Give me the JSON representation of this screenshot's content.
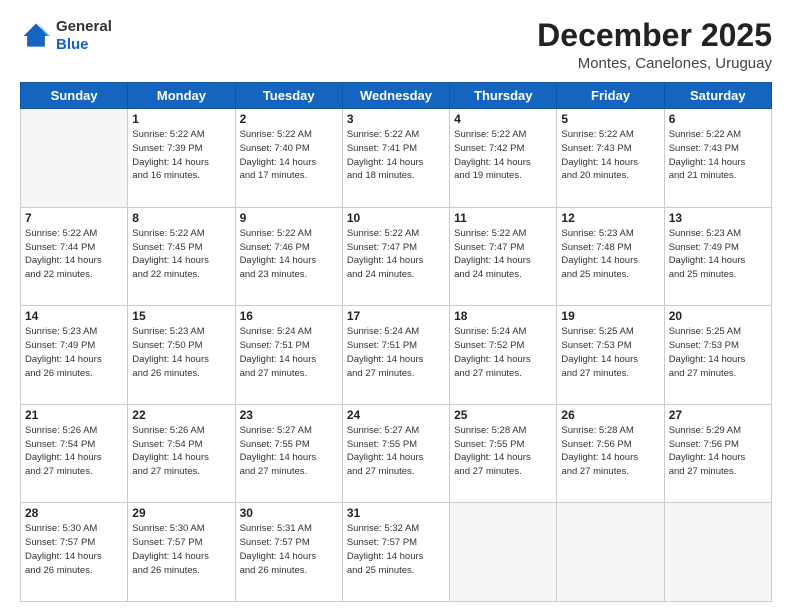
{
  "header": {
    "logo_line1": "General",
    "logo_line2": "Blue",
    "month": "December 2025",
    "location": "Montes, Canelones, Uruguay"
  },
  "days_of_week": [
    "Sunday",
    "Monday",
    "Tuesday",
    "Wednesday",
    "Thursday",
    "Friday",
    "Saturday"
  ],
  "weeks": [
    [
      {
        "day": "",
        "info": ""
      },
      {
        "day": "1",
        "info": "Sunrise: 5:22 AM\nSunset: 7:39 PM\nDaylight: 14 hours\nand 16 minutes."
      },
      {
        "day": "2",
        "info": "Sunrise: 5:22 AM\nSunset: 7:40 PM\nDaylight: 14 hours\nand 17 minutes."
      },
      {
        "day": "3",
        "info": "Sunrise: 5:22 AM\nSunset: 7:41 PM\nDaylight: 14 hours\nand 18 minutes."
      },
      {
        "day": "4",
        "info": "Sunrise: 5:22 AM\nSunset: 7:42 PM\nDaylight: 14 hours\nand 19 minutes."
      },
      {
        "day": "5",
        "info": "Sunrise: 5:22 AM\nSunset: 7:43 PM\nDaylight: 14 hours\nand 20 minutes."
      },
      {
        "day": "6",
        "info": "Sunrise: 5:22 AM\nSunset: 7:43 PM\nDaylight: 14 hours\nand 21 minutes."
      }
    ],
    [
      {
        "day": "7",
        "info": "Sunrise: 5:22 AM\nSunset: 7:44 PM\nDaylight: 14 hours\nand 22 minutes."
      },
      {
        "day": "8",
        "info": "Sunrise: 5:22 AM\nSunset: 7:45 PM\nDaylight: 14 hours\nand 22 minutes."
      },
      {
        "day": "9",
        "info": "Sunrise: 5:22 AM\nSunset: 7:46 PM\nDaylight: 14 hours\nand 23 minutes."
      },
      {
        "day": "10",
        "info": "Sunrise: 5:22 AM\nSunset: 7:47 PM\nDaylight: 14 hours\nand 24 minutes."
      },
      {
        "day": "11",
        "info": "Sunrise: 5:22 AM\nSunset: 7:47 PM\nDaylight: 14 hours\nand 24 minutes."
      },
      {
        "day": "12",
        "info": "Sunrise: 5:23 AM\nSunset: 7:48 PM\nDaylight: 14 hours\nand 25 minutes."
      },
      {
        "day": "13",
        "info": "Sunrise: 5:23 AM\nSunset: 7:49 PM\nDaylight: 14 hours\nand 25 minutes."
      }
    ],
    [
      {
        "day": "14",
        "info": "Sunrise: 5:23 AM\nSunset: 7:49 PM\nDaylight: 14 hours\nand 26 minutes."
      },
      {
        "day": "15",
        "info": "Sunrise: 5:23 AM\nSunset: 7:50 PM\nDaylight: 14 hours\nand 26 minutes."
      },
      {
        "day": "16",
        "info": "Sunrise: 5:24 AM\nSunset: 7:51 PM\nDaylight: 14 hours\nand 27 minutes."
      },
      {
        "day": "17",
        "info": "Sunrise: 5:24 AM\nSunset: 7:51 PM\nDaylight: 14 hours\nand 27 minutes."
      },
      {
        "day": "18",
        "info": "Sunrise: 5:24 AM\nSunset: 7:52 PM\nDaylight: 14 hours\nand 27 minutes."
      },
      {
        "day": "19",
        "info": "Sunrise: 5:25 AM\nSunset: 7:53 PM\nDaylight: 14 hours\nand 27 minutes."
      },
      {
        "day": "20",
        "info": "Sunrise: 5:25 AM\nSunset: 7:53 PM\nDaylight: 14 hours\nand 27 minutes."
      }
    ],
    [
      {
        "day": "21",
        "info": "Sunrise: 5:26 AM\nSunset: 7:54 PM\nDaylight: 14 hours\nand 27 minutes."
      },
      {
        "day": "22",
        "info": "Sunrise: 5:26 AM\nSunset: 7:54 PM\nDaylight: 14 hours\nand 27 minutes."
      },
      {
        "day": "23",
        "info": "Sunrise: 5:27 AM\nSunset: 7:55 PM\nDaylight: 14 hours\nand 27 minutes."
      },
      {
        "day": "24",
        "info": "Sunrise: 5:27 AM\nSunset: 7:55 PM\nDaylight: 14 hours\nand 27 minutes."
      },
      {
        "day": "25",
        "info": "Sunrise: 5:28 AM\nSunset: 7:55 PM\nDaylight: 14 hours\nand 27 minutes."
      },
      {
        "day": "26",
        "info": "Sunrise: 5:28 AM\nSunset: 7:56 PM\nDaylight: 14 hours\nand 27 minutes."
      },
      {
        "day": "27",
        "info": "Sunrise: 5:29 AM\nSunset: 7:56 PM\nDaylight: 14 hours\nand 27 minutes."
      }
    ],
    [
      {
        "day": "28",
        "info": "Sunrise: 5:30 AM\nSunset: 7:57 PM\nDaylight: 14 hours\nand 26 minutes."
      },
      {
        "day": "29",
        "info": "Sunrise: 5:30 AM\nSunset: 7:57 PM\nDaylight: 14 hours\nand 26 minutes."
      },
      {
        "day": "30",
        "info": "Sunrise: 5:31 AM\nSunset: 7:57 PM\nDaylight: 14 hours\nand 26 minutes."
      },
      {
        "day": "31",
        "info": "Sunrise: 5:32 AM\nSunset: 7:57 PM\nDaylight: 14 hours\nand 25 minutes."
      },
      {
        "day": "",
        "info": ""
      },
      {
        "day": "",
        "info": ""
      },
      {
        "day": "",
        "info": ""
      }
    ]
  ]
}
